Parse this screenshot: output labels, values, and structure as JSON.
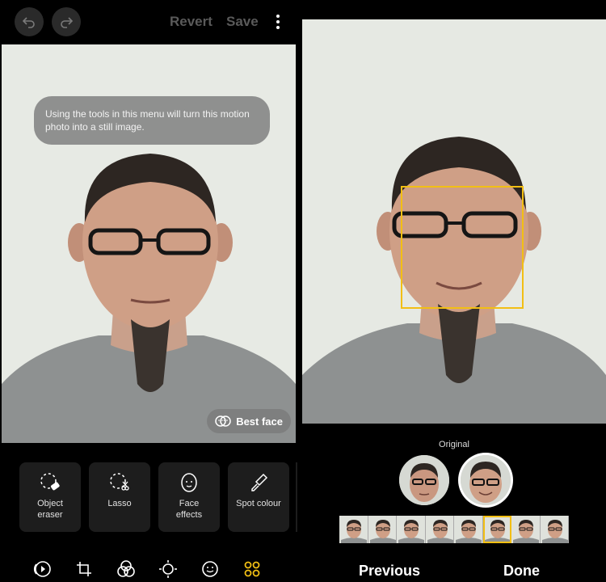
{
  "left": {
    "topbar": {
      "undo_icon": "undo-icon",
      "redo_icon": "redo-icon",
      "revert_label": "Revert",
      "save_label": "Save",
      "more_icon": "kebab-menu-icon"
    },
    "tip_text": "Using the tools in this menu will turn this motion photo into a still image.",
    "best_face_label": "Best face",
    "tools": [
      {
        "label": "Object\neraser",
        "icon": "object-eraser-icon"
      },
      {
        "label": "Lasso",
        "icon": "lasso-icon"
      },
      {
        "label": "Face\neffects",
        "icon": "face-effects-icon"
      },
      {
        "label": "Spot colour",
        "icon": "spot-colour-icon"
      }
    ],
    "bottom_nav": [
      {
        "icon": "motion-photo-icon"
      },
      {
        "icon": "crop-rotate-icon"
      },
      {
        "icon": "filters-icon"
      },
      {
        "icon": "adjust-brightness-icon"
      },
      {
        "icon": "sticker-icon"
      },
      {
        "icon": "more-tools-icon",
        "active": true,
        "color": "#f2bf14"
      }
    ]
  },
  "right": {
    "original_label": "Original",
    "face_options": [
      {
        "icon": "original-face-thumbnail"
      },
      {
        "icon": "alternate-face-thumbnail",
        "selected": true
      }
    ],
    "filmstrip_selected_index": 5,
    "filmstrip_count": 8,
    "previous_label": "Previous",
    "done_label": "Done",
    "accent_color": "#f2bf14"
  }
}
